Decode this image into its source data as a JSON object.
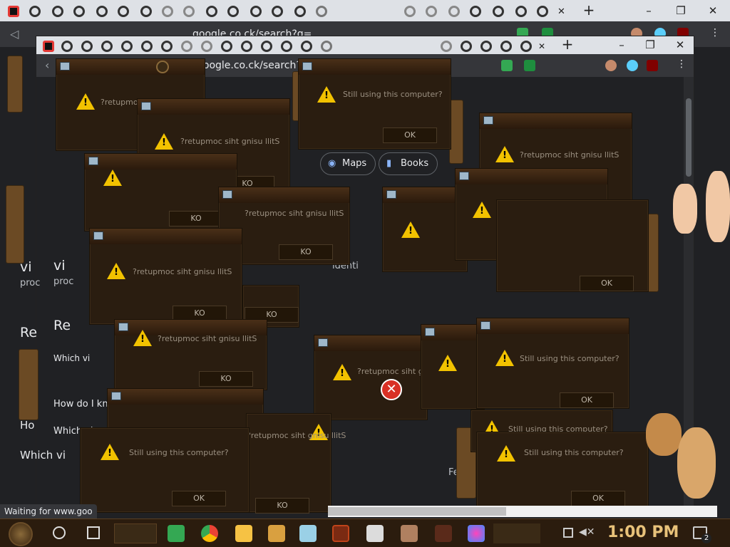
{
  "browser_back": {
    "tabs_count": 26,
    "new_tab_label": "+",
    "url": "google.co.ck/search?q=",
    "window_controls": {
      "minimize": "–",
      "restore": "❐",
      "close": "✕"
    },
    "menu": "⋮"
  },
  "browser_front": {
    "url": "google.co.ck/search?q",
    "new_tab_label": "+",
    "window_controls": {
      "minimize": "–",
      "restore": "❐",
      "close": "✕"
    },
    "menu": "⋮"
  },
  "search_chips": [
    {
      "label": "Maps",
      "icon": "pin-icon"
    },
    {
      "label": "Books",
      "icon": "book-icon"
    }
  ],
  "page_text": {
    "vi_a": "vi",
    "vi_b": "vi",
    "proc_a": "proc",
    "proc_b": "proc",
    "re_a": "Re",
    "re_b": "Re",
    "wh": "Wh",
    "ho_a": "Ho",
    "how_do": "How do I kn",
    "which_a": "Which vi",
    "which_b": "Which virus",
    "which_c": "Which vi",
    "feedback": "Fe",
    "identi": "identi"
  },
  "dialogs": {
    "still_using": "Still using this computer?",
    "reversed": "?retupmoc siht gnisu llitS",
    "ok": "OK",
    "ko": "KO"
  },
  "status_bar": "Waiting for www.goo",
  "taskbar": {
    "clock": "1:00 PM",
    "notification_count": "2"
  }
}
